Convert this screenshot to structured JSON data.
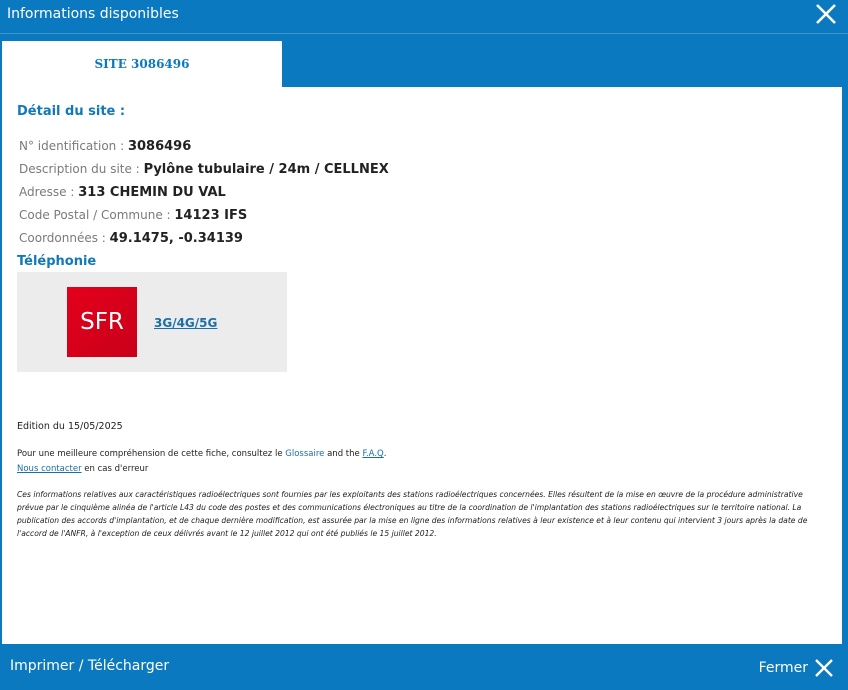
{
  "header": {
    "title": "Informations disponibles"
  },
  "tab": {
    "label": "SITE 3086496"
  },
  "detail": {
    "title": "Détail du site :",
    "fields": [
      {
        "label": "N° identification :",
        "value": "3086496"
      },
      {
        "label": "Description du site :",
        "value": "Pylône tubulaire / 24m / CELLNEX"
      },
      {
        "label": "Adresse :",
        "value": "313 CHEMIN DU VAL"
      },
      {
        "label": "Code Postal / Commune :",
        "value": "14123 IFS"
      },
      {
        "label": "Coordonnées :",
        "value": "49.1475, -0.34139"
      }
    ]
  },
  "telephonie": {
    "title": "Téléphonie",
    "operator": {
      "logo_text": "SFR",
      "technologies": "3G/4G/5G"
    }
  },
  "edition": "Edition du 15/05/2025",
  "info": {
    "prefix": "Pour une meilleure compréhension de cette fiche, consultez le ",
    "glossaire": "Glossaire",
    "and": " and the ",
    "faq": "F.A.Q",
    "period": ".",
    "contact": "Nous contacter",
    "contact_suffix": " en cas d'erreur"
  },
  "disclaimer": "Ces informations relatives aux caractéristiques radioélectriques sont fournies par les exploitants des stations radioélectriques concernées. Elles résultent de la mise en œuvre de la procédure administrative prévue par le cinquième alinéa de l'article L43 du code des postes et des communications électroniques au titre de la coordination de l'implantation des stations radioélectriques sur le territoire national. La publication des accords d'implantation, et de chaque dernière modification, est assurée par la mise en ligne des informations relatives à leur existence et à leur contenu qui intervient 3 jours après la date de l'accord de l'ANFR, à l'exception de ceux délivrés avant le 12 juillet 2012 qui ont été publiés le 15 juillet 2012.",
  "footer": {
    "print_label": "Imprimer / Télécharger",
    "close_label": "Fermer"
  },
  "colors": {
    "primary": "#0a79bf",
    "link": "#1a6fa8",
    "sfr_red": "#e4001b",
    "panel_bg": "#ececec"
  },
  "icons": {
    "close": "close-icon"
  }
}
